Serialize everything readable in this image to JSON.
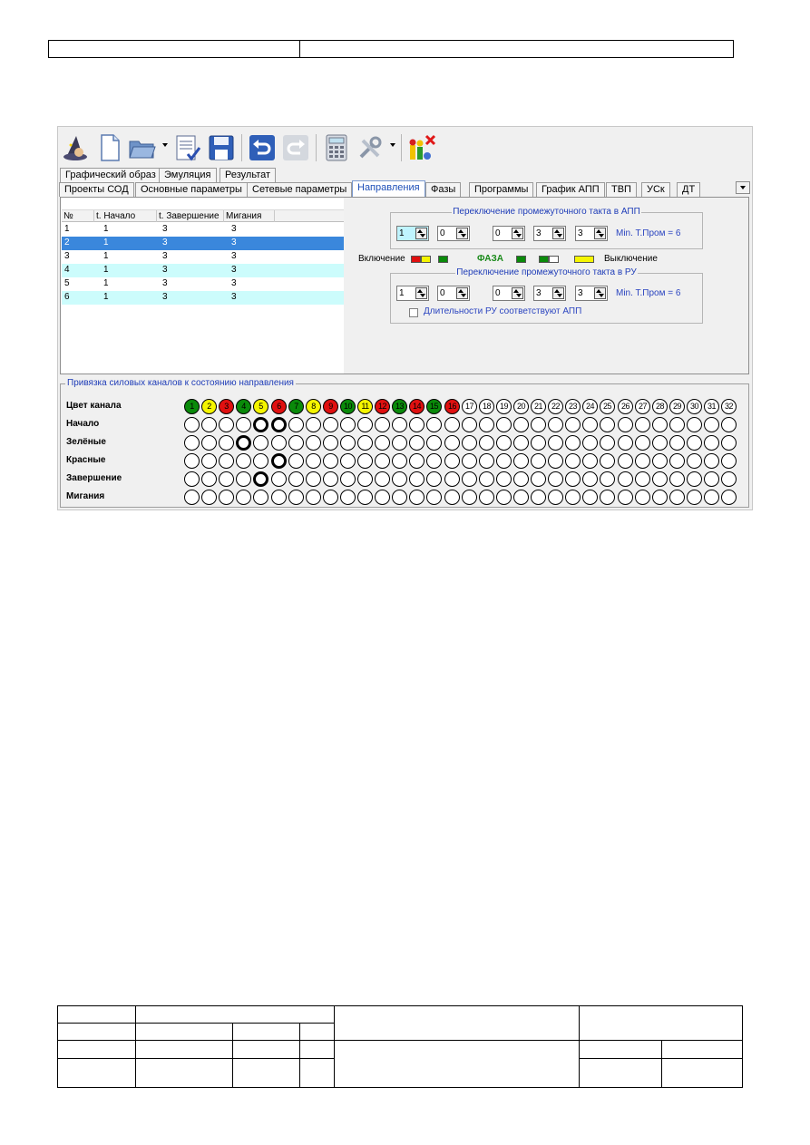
{
  "window": {
    "tabs_row_top": [
      "Графический образ",
      "Эмуляция",
      "Результат"
    ],
    "tabs_row_main": [
      "Проекты СОД",
      "Основные параметры",
      "Сетевые параметры",
      "Направления",
      "Фазы",
      "Программы",
      "График АПП",
      "ТВП",
      "УСк",
      "ДТ"
    ],
    "active_tab": "Направления"
  },
  "list": {
    "columns": [
      "№",
      "t. Начало",
      "t. Завершение",
      "Мигания"
    ],
    "rows": [
      [
        "1",
        "1",
        "3",
        "3"
      ],
      [
        "2",
        "1",
        "3",
        "3"
      ],
      [
        "3",
        "1",
        "3",
        "3"
      ],
      [
        "4",
        "1",
        "3",
        "3"
      ],
      [
        "5",
        "1",
        "3",
        "3"
      ],
      [
        "6",
        "1",
        "3",
        "3"
      ]
    ],
    "selected_row": 2
  },
  "app_group": {
    "title": "Переключение промежуточного такта в АПП",
    "values": [
      "1",
      "0",
      "0",
      "3",
      "3"
    ],
    "min_label": "Min. T.Пром = 6"
  },
  "phase_line": {
    "on_label": "Включение",
    "phase_label": "ФАЗА",
    "off_label": "Выключение"
  },
  "ru_group": {
    "title": "Переключение промежуточного такта в РУ",
    "values": [
      "1",
      "0",
      "0",
      "3",
      "3"
    ],
    "min_label": "Min. T.Пром = 6",
    "checkbox_label": "Длительности РУ соответствуют АПП"
  },
  "binding": {
    "title": "Привязка силовых каналов к состоянию направления",
    "row_labels": [
      "Цвет канала",
      "Начало",
      "Зелёные",
      "Красные",
      "Завершение",
      "Мигания"
    ],
    "channels": [
      "1",
      "2",
      "3",
      "4",
      "5",
      "6",
      "7",
      "8",
      "9",
      "10",
      "11",
      "12",
      "13",
      "14",
      "15",
      "16",
      "17",
      "18",
      "19",
      "20",
      "21",
      "22",
      "23",
      "24",
      "25",
      "26",
      "27",
      "28",
      "29",
      "30",
      "31",
      "32"
    ],
    "channel_colors": [
      "#0a8a0a",
      "#f5f500",
      "#e01010",
      "#0a8a0a",
      "#f5f500",
      "#e01010",
      "#0a8a0a",
      "#f5f500",
      "#e01010",
      "#0a8a0a",
      "#f5f500",
      "#e01010",
      "#0a8a0a",
      "#e01010",
      "#0a8a0a",
      "#e01010",
      "#ffffff",
      "#ffffff",
      "#ffffff",
      "#ffffff",
      "#ffffff",
      "#ffffff",
      "#ffffff",
      "#ffffff",
      "#ffffff",
      "#ffffff",
      "#ffffff",
      "#ffffff",
      "#ffffff",
      "#ffffff",
      "#ffffff",
      "#ffffff"
    ],
    "selected": {
      "Начало": [
        5,
        6
      ],
      "Зелёные": [
        4
      ],
      "Красные": [
        6
      ],
      "Завершение": [
        5
      ],
      "Мигания": []
    }
  }
}
